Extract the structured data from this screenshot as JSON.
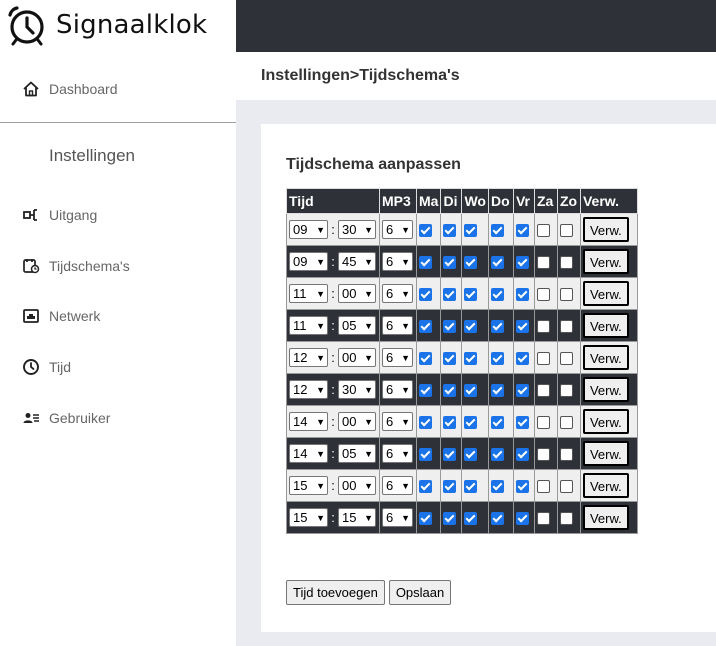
{
  "brand": {
    "name": "Signaalklok"
  },
  "sidebar": {
    "items": [
      {
        "label": "Dashboard",
        "icon": "home-icon"
      },
      {
        "label": "Uitgang",
        "icon": "output-icon"
      },
      {
        "label": "Tijdschema's",
        "icon": "schedule-icon"
      },
      {
        "label": "Netwerk",
        "icon": "network-icon"
      },
      {
        "label": "Tijd",
        "icon": "clock-icon"
      },
      {
        "label": "Gebruiker",
        "icon": "user-icon"
      }
    ],
    "section_title": "Instellingen"
  },
  "header": {
    "breadcrumb": "Instellingen>Tijdschema's"
  },
  "card": {
    "title": "Tijdschema aanpassen"
  },
  "table": {
    "headers": [
      "Tijd",
      "MP3",
      "Ma",
      "Di",
      "Wo",
      "Do",
      "Vr",
      "Za",
      "Zo",
      "Verw."
    ],
    "rows": [
      {
        "hour": "09",
        "minute": "30",
        "mp3": "6",
        "days": [
          true,
          true,
          true,
          true,
          true,
          false,
          false
        ],
        "delete_label": "Verw."
      },
      {
        "hour": "09",
        "minute": "45",
        "mp3": "6",
        "days": [
          true,
          true,
          true,
          true,
          true,
          false,
          false
        ],
        "delete_label": "Verw."
      },
      {
        "hour": "11",
        "minute": "00",
        "mp3": "6",
        "days": [
          true,
          true,
          true,
          true,
          true,
          false,
          false
        ],
        "delete_label": "Verw."
      },
      {
        "hour": "11",
        "minute": "05",
        "mp3": "6",
        "days": [
          true,
          true,
          true,
          true,
          true,
          false,
          false
        ],
        "delete_label": "Verw."
      },
      {
        "hour": "12",
        "minute": "00",
        "mp3": "6",
        "days": [
          true,
          true,
          true,
          true,
          true,
          false,
          false
        ],
        "delete_label": "Verw."
      },
      {
        "hour": "12",
        "minute": "30",
        "mp3": "6",
        "days": [
          true,
          true,
          true,
          true,
          true,
          false,
          false
        ],
        "delete_label": "Verw."
      },
      {
        "hour": "14",
        "minute": "00",
        "mp3": "6",
        "days": [
          true,
          true,
          true,
          true,
          true,
          false,
          false
        ],
        "delete_label": "Verw."
      },
      {
        "hour": "14",
        "minute": "05",
        "mp3": "6",
        "days": [
          true,
          true,
          true,
          true,
          true,
          false,
          false
        ],
        "delete_label": "Verw."
      },
      {
        "hour": "15",
        "minute": "00",
        "mp3": "6",
        "days": [
          true,
          true,
          true,
          true,
          true,
          false,
          false
        ],
        "delete_label": "Verw."
      },
      {
        "hour": "15",
        "minute": "15",
        "mp3": "6",
        "days": [
          true,
          true,
          true,
          true,
          true,
          false,
          false
        ],
        "delete_label": "Verw."
      }
    ]
  },
  "actions": {
    "add_label": "Tijd toevoegen",
    "save_label": "Opslaan"
  },
  "colors": {
    "topbar": "#2f3138",
    "checkbox": "#1a73e8",
    "background": "#e9ebf0"
  }
}
